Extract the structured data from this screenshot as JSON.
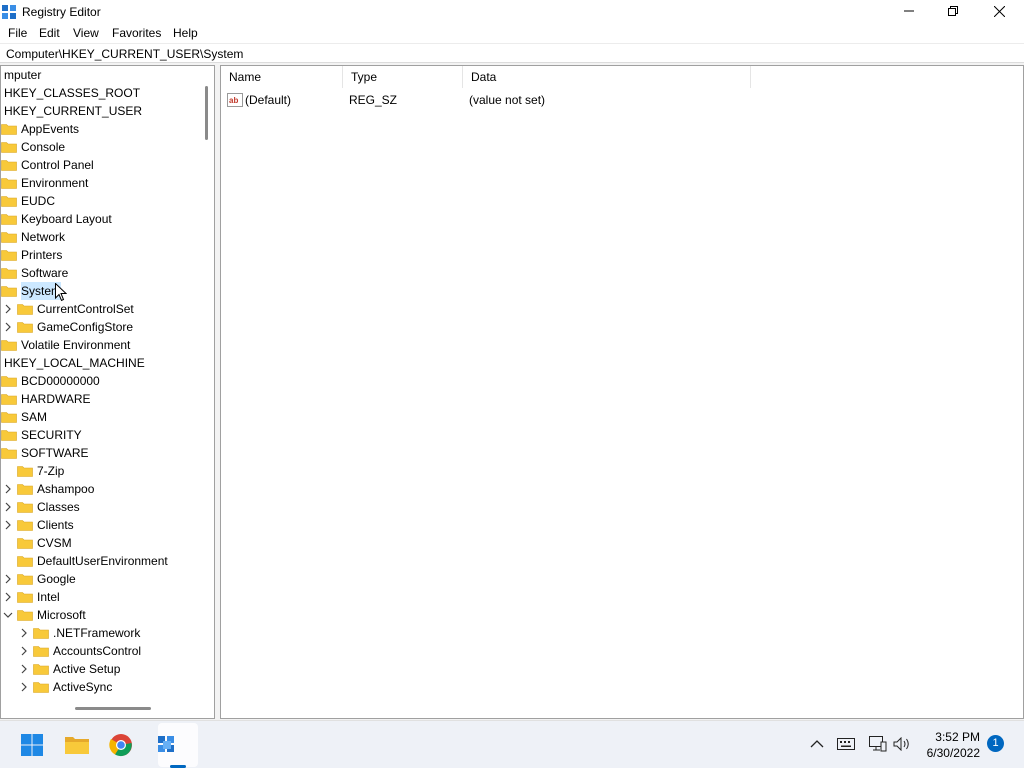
{
  "window": {
    "title": "Registry Editor",
    "controls": [
      "minimize",
      "restore",
      "close"
    ]
  },
  "menu": [
    "File",
    "Edit",
    "View",
    "Favorites",
    "Help"
  ],
  "address": "Computer\\HKEY_CURRENT_USER\\System",
  "tree": [
    {
      "label": "mputer",
      "level": 0,
      "folder": false,
      "chevron": "none"
    },
    {
      "label": "HKEY_CLASSES_ROOT",
      "level": 0,
      "folder": false,
      "chevron": "none"
    },
    {
      "label": "HKEY_CURRENT_USER",
      "level": 0,
      "folder": false,
      "chevron": "none"
    },
    {
      "label": "AppEvents",
      "level": 1,
      "folder": true,
      "chevron": "none"
    },
    {
      "label": "Console",
      "level": 1,
      "folder": true,
      "chevron": "none"
    },
    {
      "label": "Control Panel",
      "level": 1,
      "folder": true,
      "chevron": "none"
    },
    {
      "label": "Environment",
      "level": 1,
      "folder": true,
      "chevron": "none"
    },
    {
      "label": "EUDC",
      "level": 1,
      "folder": true,
      "chevron": "none"
    },
    {
      "label": "Keyboard Layout",
      "level": 1,
      "folder": true,
      "chevron": "none"
    },
    {
      "label": "Network",
      "level": 1,
      "folder": true,
      "chevron": "none"
    },
    {
      "label": "Printers",
      "level": 1,
      "folder": true,
      "chevron": "none"
    },
    {
      "label": "Software",
      "level": 1,
      "folder": true,
      "chevron": "none"
    },
    {
      "label": "System",
      "level": 1,
      "folder": true,
      "chevron": "none",
      "selected": true
    },
    {
      "label": "CurrentControlSet",
      "level": 2,
      "folder": true,
      "chevron": "right"
    },
    {
      "label": "GameConfigStore",
      "level": 2,
      "folder": true,
      "chevron": "right"
    },
    {
      "label": "Volatile Environment",
      "level": 1,
      "folder": true,
      "chevron": "none"
    },
    {
      "label": "HKEY_LOCAL_MACHINE",
      "level": 0,
      "folder": false,
      "chevron": "none"
    },
    {
      "label": "BCD00000000",
      "level": 1,
      "folder": true,
      "chevron": "none"
    },
    {
      "label": "HARDWARE",
      "level": 1,
      "folder": true,
      "chevron": "none"
    },
    {
      "label": "SAM",
      "level": 1,
      "folder": true,
      "chevron": "none"
    },
    {
      "label": "SECURITY",
      "level": 1,
      "folder": true,
      "chevron": "none"
    },
    {
      "label": "SOFTWARE",
      "level": 1,
      "folder": true,
      "chevron": "none"
    },
    {
      "label": "7-Zip",
      "level": 2,
      "folder": true,
      "chevron": "none"
    },
    {
      "label": "Ashampoo",
      "level": 2,
      "folder": true,
      "chevron": "right"
    },
    {
      "label": "Classes",
      "level": 2,
      "folder": true,
      "chevron": "right"
    },
    {
      "label": "Clients",
      "level": 2,
      "folder": true,
      "chevron": "right"
    },
    {
      "label": "CVSM",
      "level": 2,
      "folder": true,
      "chevron": "none"
    },
    {
      "label": "DefaultUserEnvironment",
      "level": 2,
      "folder": true,
      "chevron": "none"
    },
    {
      "label": "Google",
      "level": 2,
      "folder": true,
      "chevron": "right"
    },
    {
      "label": "Intel",
      "level": 2,
      "folder": true,
      "chevron": "right"
    },
    {
      "label": "Microsoft",
      "level": 2,
      "folder": true,
      "chevron": "down"
    },
    {
      "label": ".NETFramework",
      "level": 3,
      "folder": true,
      "chevron": "right"
    },
    {
      "label": "AccountsControl",
      "level": 3,
      "folder": true,
      "chevron": "right"
    },
    {
      "label": "Active Setup",
      "level": 3,
      "folder": true,
      "chevron": "right"
    },
    {
      "label": "ActiveSync",
      "level": 3,
      "folder": true,
      "chevron": "right"
    }
  ],
  "list": {
    "columns": [
      "Name",
      "Type",
      "Data"
    ],
    "rows": [
      {
        "name": "(Default)",
        "type": "REG_SZ",
        "data": "(value not set)"
      }
    ]
  },
  "taskbar": {
    "apps": [
      "start-icon",
      "file-explorer-icon",
      "chrome-icon",
      "registry-editor-icon"
    ],
    "tray": [
      "chevron-up-icon",
      "keyboard-icon",
      "network-icon",
      "volume-icon"
    ],
    "time": "3:52 PM",
    "date": "6/30/2022",
    "notifications": "1"
  },
  "colors": {
    "selection": "#cce8ff",
    "folder": "#f8c93a",
    "accent": "#0067c0"
  }
}
